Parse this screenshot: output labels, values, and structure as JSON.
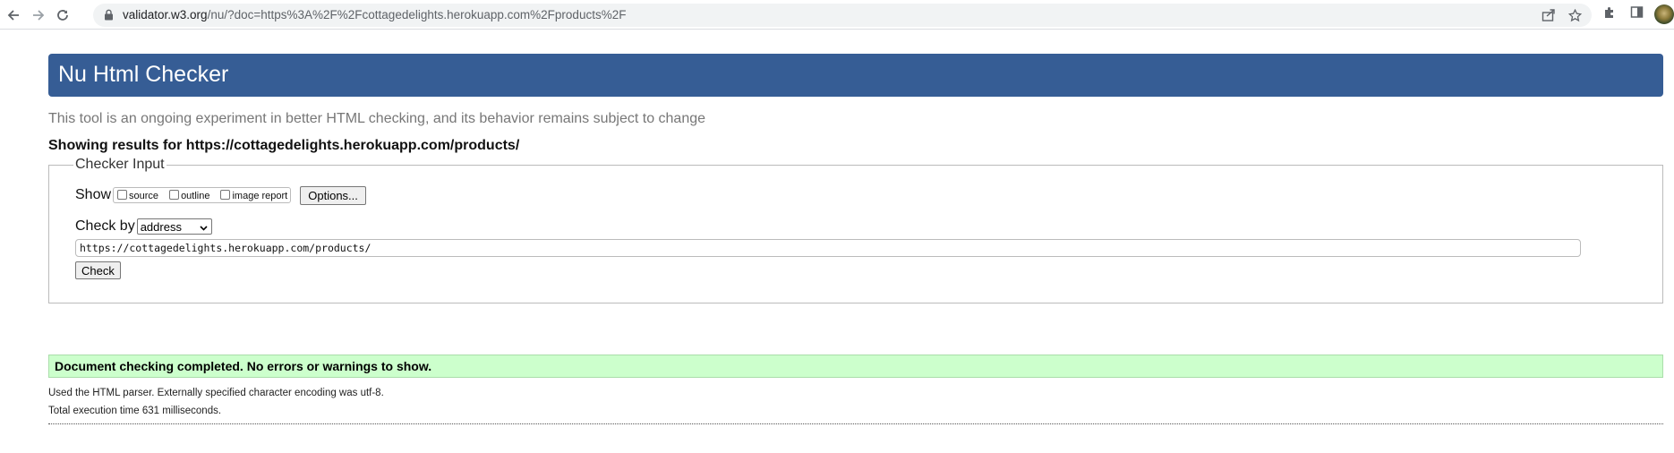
{
  "browser": {
    "url_host": "validator.w3.org",
    "url_rest": "/nu/?doc=https%3A%2F%2Fcottagedelights.herokuapp.com%2Fproducts%2F",
    "icons": [
      "back-arrow-icon",
      "forward-arrow-icon",
      "reload-icon",
      "lock-icon",
      "share-icon",
      "bookmark-star-icon",
      "extensions-puzzle-icon",
      "side-panel-icon",
      "profile-avatar"
    ]
  },
  "header": {
    "title": "Nu Html Checker",
    "background": "#365d95"
  },
  "intro": "This tool is an ongoing experiment in better HTML checking, and its behavior remains subject to change",
  "showing_results": "Showing results for https://cottagedelights.herokuapp.com/products/",
  "checker_input": {
    "legend": "Checker Input",
    "show_label": "Show",
    "checkboxes": [
      {
        "label": "source",
        "checked": false
      },
      {
        "label": "outline",
        "checked": false
      },
      {
        "label": "image report",
        "checked": false
      }
    ],
    "options_button": "Options...",
    "check_by_label": "Check by",
    "check_by_value": "address",
    "address_value": "https://cottagedelights.herokuapp.com/products/",
    "check_button": "Check"
  },
  "result": {
    "message": "Document checking completed. No errors or warnings to show.",
    "background": "#ccffcc"
  },
  "info": {
    "parser": "Used the HTML parser. Externally specified character encoding was utf-8.",
    "execution": "Total execution time 631 milliseconds."
  }
}
